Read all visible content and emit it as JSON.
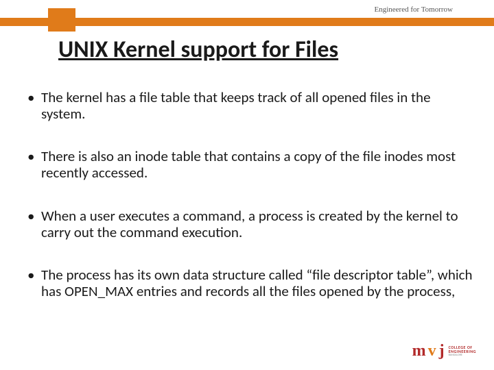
{
  "tagline": "Engineered for Tomorrow",
  "title": "UNIX Kernel support for Files",
  "bullets": [
    "The kernel has a file table that keeps track of all opened files in the system.",
    "There is also an inode table that contains a copy of the file inodes most recently accessed.",
    "When a user executes a command, a process is created by the kernel to carry out the command execution.",
    "The process has its own data structure called “file descriptor table”, which has OPEN_MAX entries and records  all the files opened by the process,"
  ],
  "logo": {
    "m": "m",
    "v": "v",
    "j": "j",
    "line1": "COLLEGE OF",
    "line2": "ENGINEERING",
    "sub": "BANGALORE"
  }
}
